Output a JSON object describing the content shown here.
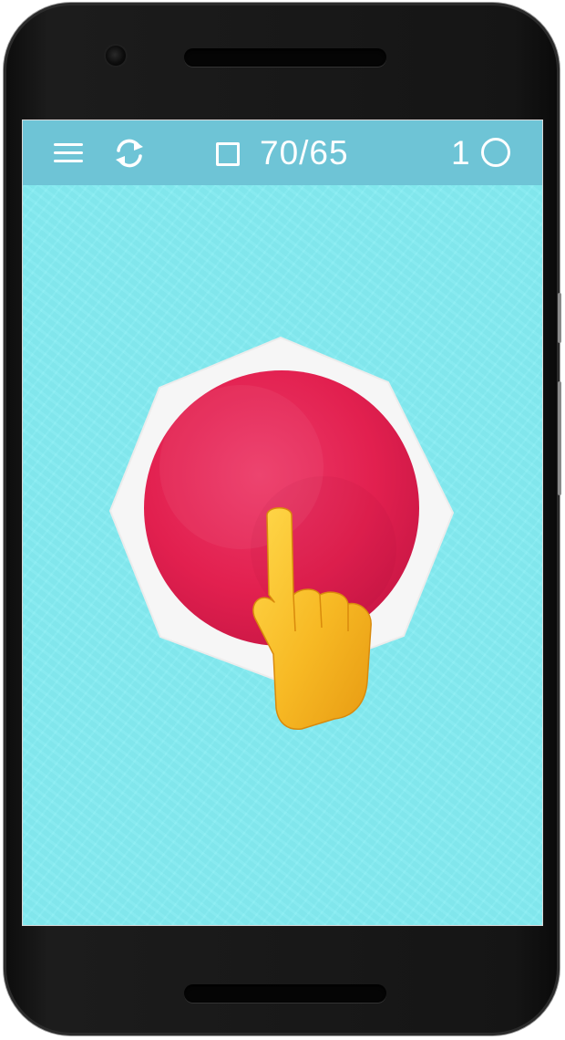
{
  "game": {
    "level_progress": "70/65",
    "score": "1"
  },
  "icons": {
    "menu": "menu-icon",
    "restart": "refresh-icon",
    "moves": "square-icon",
    "score": "circle-icon",
    "hint": "pointing-finger-icon"
  },
  "colors": {
    "background": "#84ecf2",
    "topbar": "#6ec4d6",
    "target": "#e6204f",
    "octagon": "#f5f5f5",
    "hand": "#f6b820"
  }
}
